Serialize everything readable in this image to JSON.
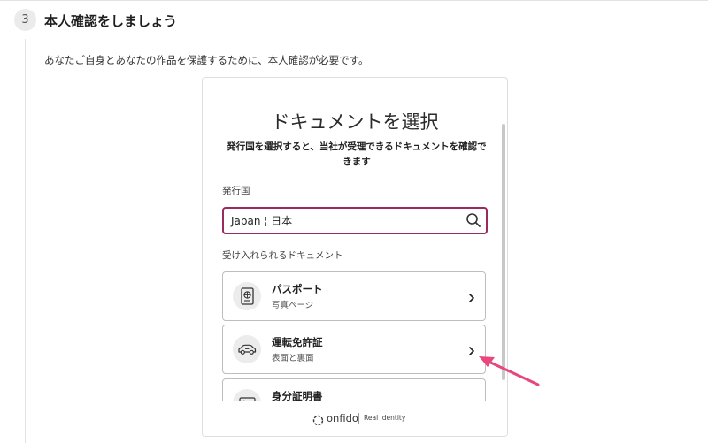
{
  "step": {
    "number": "3",
    "title": "本人確認をしましょう",
    "description": "あなたご自身とあなたの作品を保護するために、本人確認が必要です。"
  },
  "widget": {
    "title": "ドキュメントを選択",
    "subtitle": "発行国を選択すると、当社が受理できるドキュメントを確認できます",
    "country_label": "発行国",
    "country_value": "Japan ¦ 日本",
    "accepted_label": "受け入れられるドキュメント",
    "documents": [
      {
        "name": "パスポート",
        "sub": "写真ページ",
        "icon": "passport-icon"
      },
      {
        "name": "運転免許証",
        "sub": "表面と裏面",
        "icon": "car-icon"
      },
      {
        "name": "身分証明書",
        "sub": "",
        "icon": "id-card-icon"
      }
    ],
    "footer": {
      "brand": "onfido",
      "tagline": "Real Identity"
    }
  },
  "colors": {
    "accent": "#9b2b5c",
    "annotation_arrow": "#e8467c"
  }
}
